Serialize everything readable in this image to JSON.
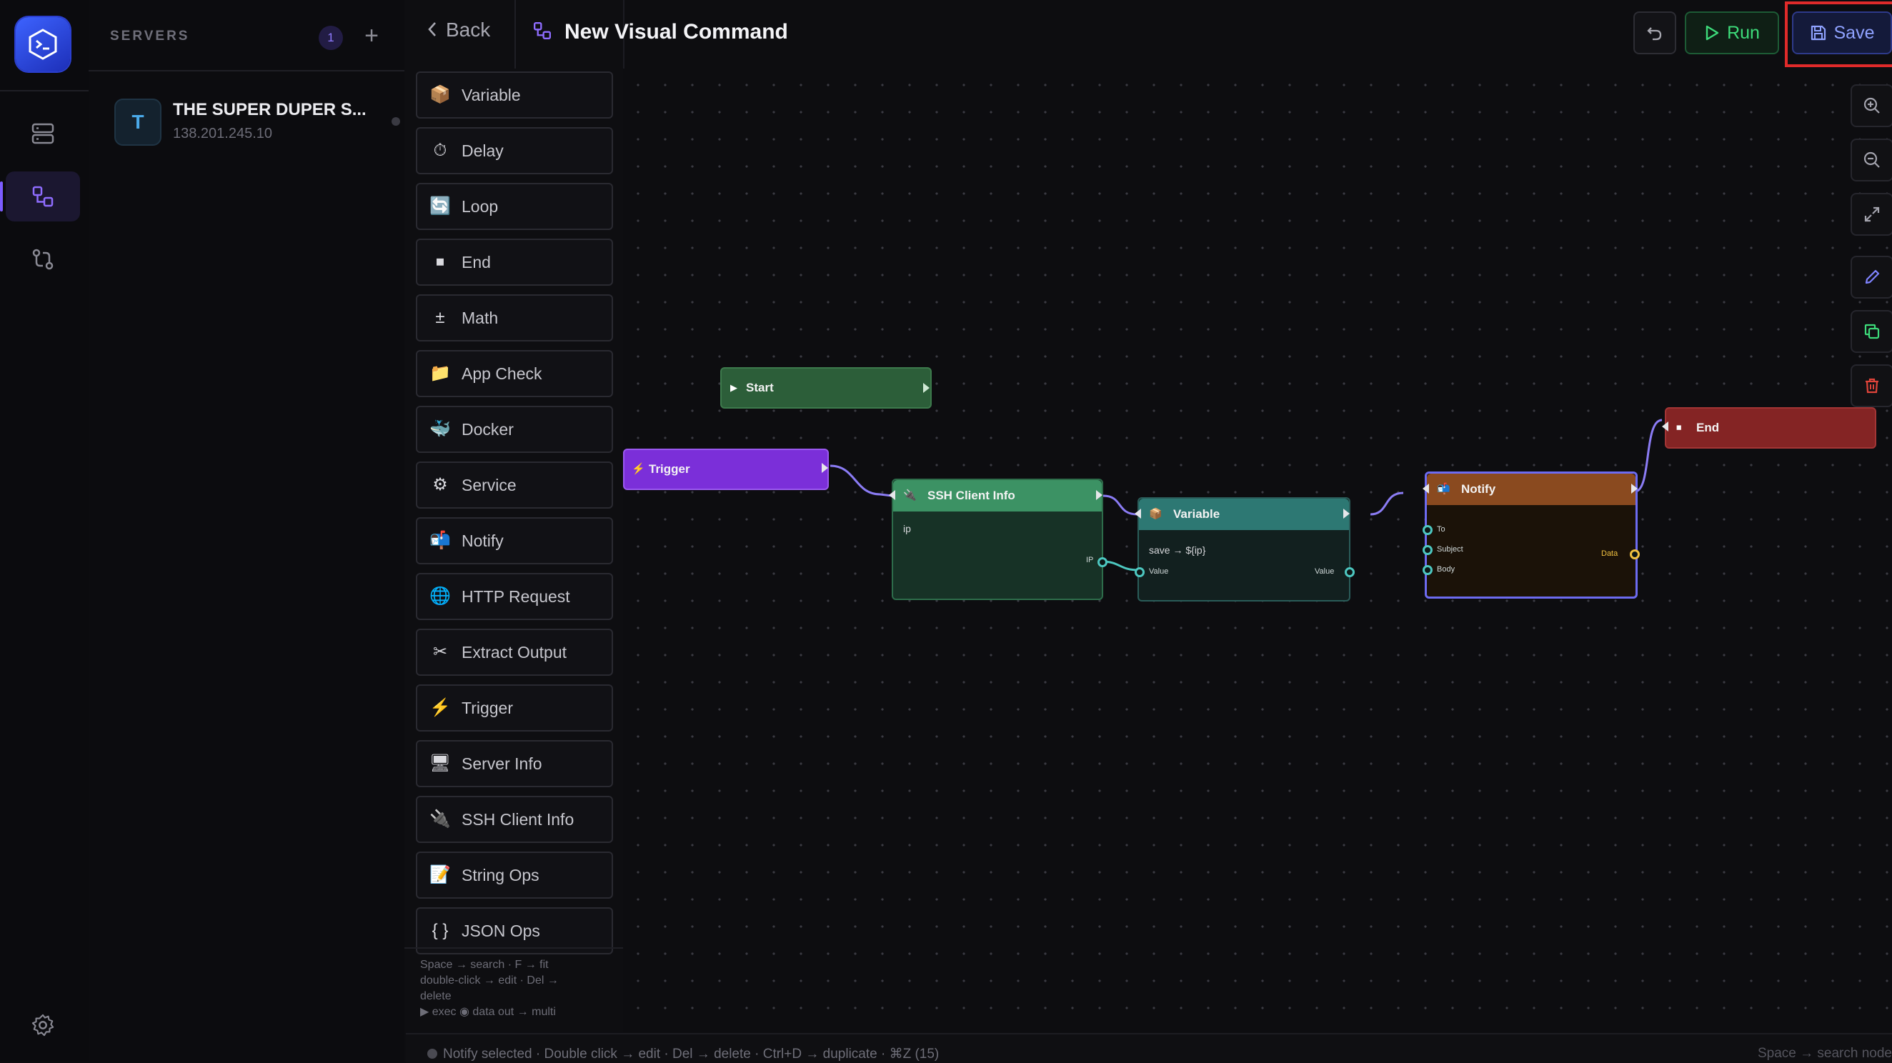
{
  "servers": {
    "title": "SERVERS",
    "count": "1",
    "add_icon": "+",
    "items": [
      {
        "initial": "T",
        "name": "THE SUPER DUPER S...",
        "ip": "138.201.245.10"
      }
    ]
  },
  "header": {
    "back_label": "Back",
    "title": "New Visual Command",
    "run_label": "Run",
    "save_label": "Save"
  },
  "palette": {
    "items": [
      {
        "icon": "📦",
        "label": "Variable"
      },
      {
        "icon": "⏱",
        "label": "Delay"
      },
      {
        "icon": "🔄",
        "label": "Loop"
      },
      {
        "icon": "⏹",
        "label": "End"
      },
      {
        "icon": "±",
        "label": "Math"
      },
      {
        "icon": "📁",
        "label": "App Check"
      },
      {
        "icon": "🐳",
        "label": "Docker"
      },
      {
        "icon": "⚙",
        "label": "Service"
      },
      {
        "icon": "📬",
        "label": "Notify"
      },
      {
        "icon": "🌐",
        "label": "HTTP Request"
      },
      {
        "icon": "✂",
        "label": "Extract Output"
      },
      {
        "icon": "⚡",
        "label": "Trigger"
      },
      {
        "icon": "🖥",
        "label": "Server Info"
      },
      {
        "icon": "🔌",
        "label": "SSH Client Info"
      },
      {
        "icon": "📝",
        "label": "String Ops"
      },
      {
        "icon": "{ }",
        "label": "JSON Ops"
      }
    ],
    "hint_1": "Space → search  ·  F → fit",
    "hint_2": "double-click → edit  ·  Del →",
    "hint_3": "delete",
    "hint_4": "▶ exec  ◉ data  out → multi"
  },
  "nodes": {
    "start": {
      "title": "Start",
      "glyph": "▶"
    },
    "trigger": {
      "title": "Trigger",
      "glyph": "⚡"
    },
    "ssh": {
      "title": "SSH Client Info",
      "glyph": "🔌",
      "field": "ip",
      "out_label": "IP"
    },
    "variable": {
      "title": "Variable",
      "glyph": "📦",
      "body": "save → ${ip}",
      "in_label": "Value",
      "out_label": "Value"
    },
    "notify": {
      "title": "Notify",
      "glyph": "📬",
      "inputs": [
        "To",
        "Subject",
        "Body"
      ],
      "out_label": "Data"
    },
    "end": {
      "title": "End",
      "glyph": "⏹"
    }
  },
  "status": {
    "left": "Notify selected  ·  Double click → edit  ·  Del → delete  ·  Ctrl+D → duplicate  ·  ⌘Z (15)",
    "right": "Space → search node"
  },
  "colors": {
    "accent": "#7c5cff",
    "run": "#3ddb7a",
    "save": "#8fa2ff",
    "start_node": "#2f6b3e",
    "trigger_node": "#8a2be2",
    "ssh_node": "#3f9a6a",
    "variable_node": "#2f7d78",
    "notify_node": "#8a4a1f",
    "end_node": "#8e2a2a",
    "highlight": "#e02a2a"
  }
}
